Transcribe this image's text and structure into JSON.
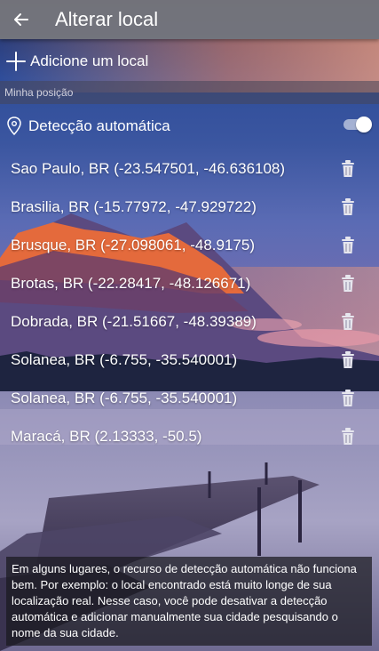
{
  "header": {
    "title": "Alterar local",
    "back_icon": "arrow-left-icon"
  },
  "add_location": {
    "label": "Adicione um local",
    "icon": "plus-icon"
  },
  "section": {
    "title": "Minha posição"
  },
  "auto_detect": {
    "label": "Detecção automática",
    "icon": "location-pin-icon",
    "enabled": true
  },
  "locations": [
    {
      "label": "Sao Paulo, BR  (-23.547501, -46.636108)"
    },
    {
      "label": "Brasilia, BR  (-15.77972, -47.929722)"
    },
    {
      "label": "Brusque, BR  (-27.098061, -48.9175)"
    },
    {
      "label": "Brotas, BR  (-22.28417, -48.126671)"
    },
    {
      "label": "Dobrada, BR  (-21.51667, -48.39389)"
    },
    {
      "label": "Solanea, BR  (-6.755, -35.540001)"
    },
    {
      "label": "Solanea, BR  (-6.755, -35.540001)"
    },
    {
      "label": "Maracá, BR  (2.13333, -50.5)"
    }
  ],
  "info": {
    "text": "Em alguns lugares, o recurso de detecção automática não funciona bem. Por exemplo: o local encontrado está muito longe de sua localização real. Nesse caso, você pode desativar a detecção automática e adicionar manualmente sua cidade pesquisando o nome da sua cidade."
  },
  "colors": {
    "appbar": "#78787d",
    "toggle_knob": "#ffffff",
    "sky_top": "#2a3160",
    "sunset": "#e06a3a",
    "lake": "#8f8fb0"
  }
}
